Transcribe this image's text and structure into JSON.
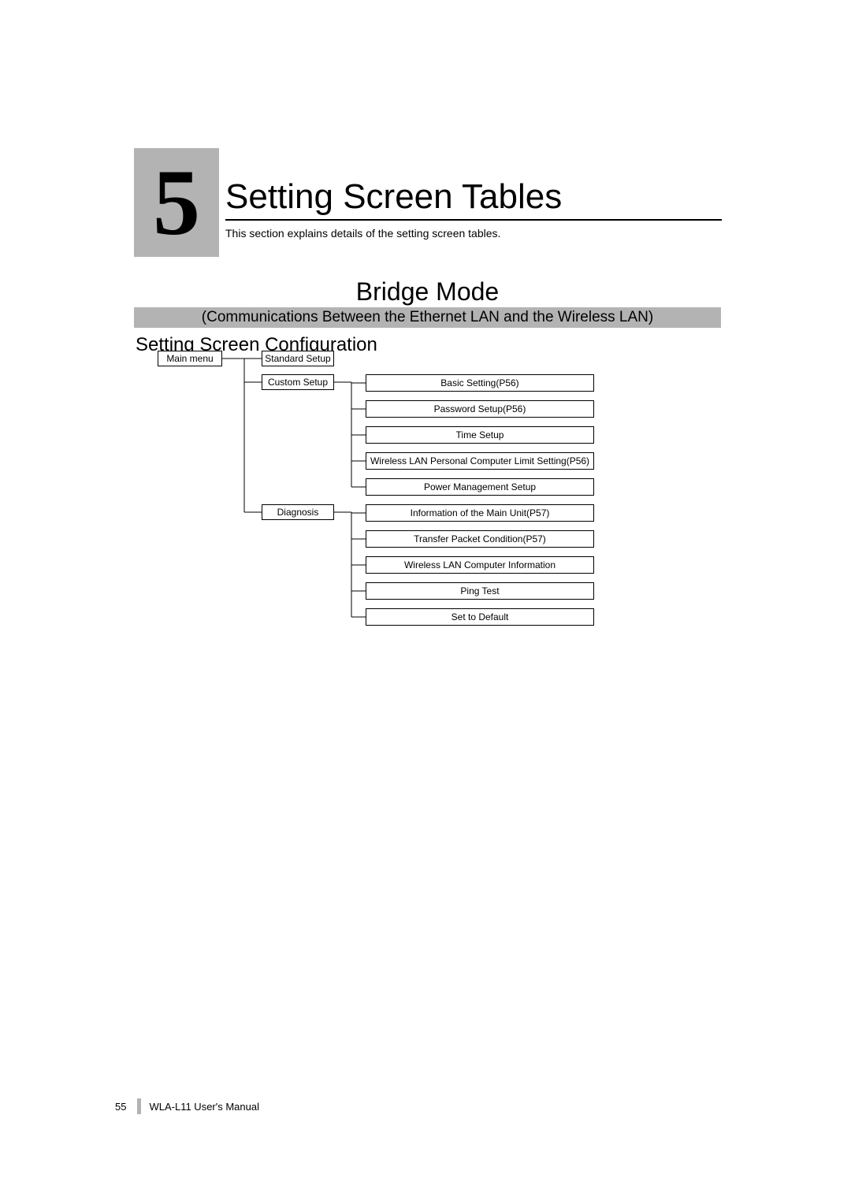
{
  "chapter": {
    "number": "5",
    "title": "Setting Screen Tables",
    "subtitle": "This section explains details of the setting screen tables."
  },
  "mode": {
    "title": "Bridge Mode",
    "subtitle": "(Communications Between the Ethernet LAN and the Wireless LAN)"
  },
  "subsection": "Setting Screen Configuration",
  "diagram": {
    "root": "Main menu",
    "level2": {
      "standard": "Standard Setup",
      "custom": "Custom Setup",
      "diagnosis": "Diagnosis"
    },
    "custom_children": [
      "Basic Setting(P56)",
      "Password Setup(P56)",
      "Time Setup",
      "Wireless LAN Personal Computer Limit Setting(P56)",
      "Power Management Setup"
    ],
    "diagnosis_children": [
      "Information of the Main Unit(P57)",
      "Transfer Packet Condition(P57)",
      "Wireless LAN Computer Information",
      "Ping Test",
      "Set to Default"
    ]
  },
  "footer": {
    "page": "55",
    "text": "WLA-L11 User's Manual"
  }
}
